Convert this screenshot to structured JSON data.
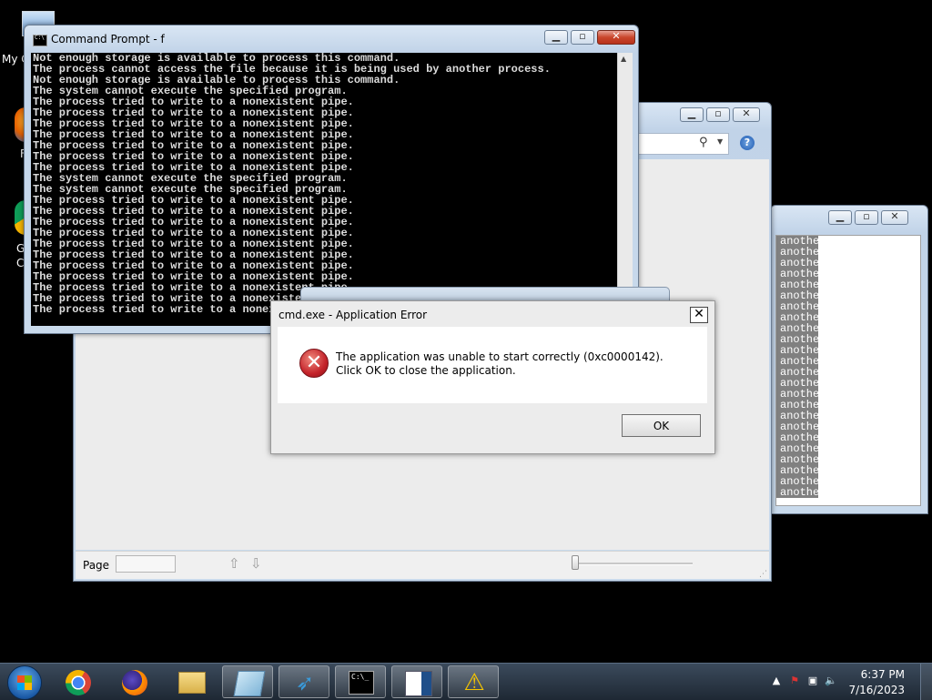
{
  "desktop": {
    "icons": [
      {
        "label": "My C",
        "icon": "computer-icon"
      },
      {
        "label": "F",
        "icon": "firefox-icon"
      },
      {
        "label": "G",
        "icon": "chrome-icon"
      },
      {
        "label": "C",
        "icon": "chrome-icon"
      }
    ]
  },
  "cmd": {
    "title": "Command Prompt - f",
    "lines": [
      "Not enough storage is available to process this command.",
      "The process cannot access the file because it is being used by another process.",
      "Not enough storage is available to process this command.",
      "The system cannot execute the specified program.",
      "The process tried to write to a nonexistent pipe.",
      "The process tried to write to a nonexistent pipe.",
      "The process tried to write to a nonexistent pipe.",
      "The process tried to write to a nonexistent pipe.",
      "The process tried to write to a nonexistent pipe.",
      "The process tried to write to a nonexistent pipe.",
      "The process tried to write to a nonexistent pipe.",
      "The system cannot execute the specified program.",
      "The system cannot execute the specified program.",
      "The process tried to write to a nonexistent pipe.",
      "The process tried to write to a nonexistent pipe.",
      "The process tried to write to a nonexistent pipe.",
      "The process tried to write to a nonexistent pipe.",
      "The process tried to write to a nonexistent pipe.",
      "The process tried to write to a nonexistent pipe.",
      "The process tried to write to a nonexistent pipe.",
      "The process tried to write to a nonexistent pipe.",
      "The process tried to write to a nonexistent pipe.",
      "The process tried to write to a nonexistent pipe.",
      "The process tried to write to a nonexistent pipe."
    ]
  },
  "viewer": {
    "page_label": "Page",
    "page_value": ""
  },
  "notepad": {
    "lines": [
      "anothe",
      "anothe",
      "anothe",
      "anothe",
      "anothe",
      "anothe",
      "anothe",
      "anothe",
      "anothe",
      "anothe",
      "anothe",
      "anothe",
      "anothe",
      "anothe",
      "anothe",
      "anothe",
      "anothe",
      "anothe",
      "anothe",
      "anothe",
      "anothe",
      "anothe",
      "anothe",
      "anothe"
    ]
  },
  "error_dialog": {
    "title": "cmd.exe - Application Error",
    "message": "The application was unable to start correctly (0xc0000142). Click OK to close the application.",
    "ok_label": "OK",
    "close_glyph": "✕"
  },
  "taskbar": {
    "items": [
      {
        "name": "chrome",
        "icon": "chrome-icon"
      },
      {
        "name": "firefox",
        "icon": "firefox-icon"
      },
      {
        "name": "explorer",
        "icon": "folder-icon"
      },
      {
        "name": "notepad",
        "icon": "notepad-icon"
      },
      {
        "name": "xnview",
        "icon": "bird-icon"
      },
      {
        "name": "cmd",
        "icon": "cmd-icon"
      },
      {
        "name": "viewer",
        "icon": "document-icon"
      },
      {
        "name": "warning",
        "icon": "warning-icon"
      }
    ],
    "time": "6:37 PM",
    "date": "7/16/2023"
  },
  "colors": {
    "console_bg": "#000000",
    "console_fg": "#dcdcdc",
    "taskbar": "#2a3646",
    "error_red": "#c4232a"
  }
}
